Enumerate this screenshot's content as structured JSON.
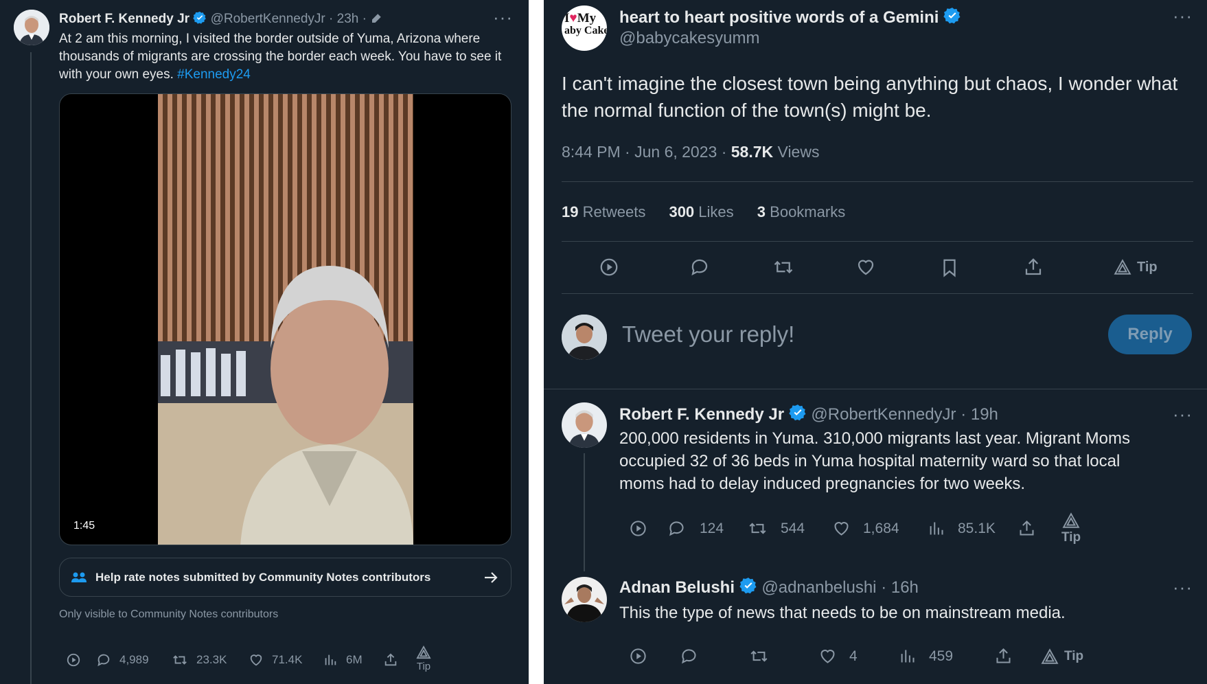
{
  "left_tweet": {
    "author_name": "Robert F. Kennedy Jr",
    "handle": "@RobertKennedyJr",
    "time": "· 23h ·",
    "text": "At 2 am this morning, I visited the border outside of Yuma, Arizona where thousands of migrants are crossing the border each week. You have to see it with your own eyes.",
    "hashtag": "#Kennedy24",
    "video_duration": "1:45",
    "community_notes_cta": "Help rate notes submitted by Community Notes contributors",
    "community_notes_visibility": "Only visible to Community Notes contributors",
    "stats": {
      "replies": "4,989",
      "retweets": "23.3K",
      "likes": "71.4K",
      "views": "6M",
      "tip": "Tip"
    }
  },
  "main_tweet": {
    "author_name": "heart to heart positive words of a Gemini",
    "handle": "@babycakesyumm",
    "avatar_text_line1": "I",
    "avatar_text_heart": "♥",
    "avatar_text_line1b": "My",
    "avatar_text_line2": "aby Cake",
    "text": "I can't imagine the closest town being anything but chaos, I wonder what the normal function of the town(s) might be.",
    "timestamp": "8:44 PM · Jun 6, 2023 ·",
    "views_count": "58.7K",
    "views_label": "Views",
    "retweets_count": "19",
    "retweets_label": "Retweets",
    "likes_count": "300",
    "likes_label": "Likes",
    "bookmarks_count": "3",
    "bookmarks_label": "Bookmarks",
    "tip": "Tip"
  },
  "composer": {
    "placeholder": "Tweet your reply!",
    "reply_button": "Reply"
  },
  "replies": [
    {
      "author_name": "Robert F. Kennedy Jr",
      "handle": "@RobertKennedyJr",
      "time": "· 19h",
      "text": "200,000 residents in Yuma. 310,000 migrants last year. Migrant Moms occupied 32 of 36 beds in Yuma hospital maternity ward so that local moms had to delay induced pregnancies for two weeks.",
      "replies": "124",
      "retweets": "544",
      "likes": "1,684",
      "views": "85.1K",
      "tip": "Tip"
    },
    {
      "author_name": "Adnan Belushi",
      "handle": "@adnanbelushi",
      "time": "· 16h",
      "text": "This the type of news that needs to be on mainstream media.",
      "replies": "",
      "retweets": "",
      "likes": "4",
      "views": "459",
      "tip": "Tip"
    }
  ],
  "colors": {
    "background": "#15202b",
    "accent": "#1d9bf0",
    "muted": "#8b98a5",
    "reply_button": "#1a5d8f"
  }
}
